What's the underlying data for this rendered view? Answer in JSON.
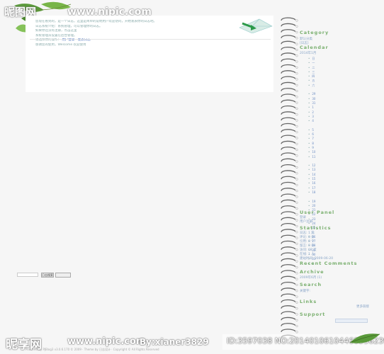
{
  "watermark": {
    "top_logo": "昵图网",
    "top_url": "www.nipic.com",
    "bottom_logo": "昵享网",
    "bottom_url": "www.nipic.com",
    "bottom_by": "By:xianer3829",
    "bottom_id": "ID:3597038 NO:20140106104460536239"
  },
  "content": {
    "lines": [
      {
        "text": "",
        "highlight": ""
      },
      {
        "text": "您现在看到的，是一个日志，这里是简单的说明用户欢迎访问，开始发表你的日志吧。",
        "highlight": ""
      },
      {
        "text": "日志系统介绍：系统管理，可以管理你的日志。",
        "highlight": ""
      },
      {
        "text": "如果你还没有注册，点击这里",
        "highlight": ""
      },
      {
        "text": "系统管理员设置在后台管理。",
        "highlight": ""
      },
      {
        "text": "请选择你的操作：",
        "highlight": "用户登录 · 发表日志"
      },
      {
        "text": "感谢您的使用，Welcome 欢迎使用",
        "highlight": ""
      }
    ]
  },
  "sidebar": {
    "category_title": "Category",
    "category_items": [
      "默认分类",
      "[日志]"
    ],
    "calendar_title": "Calendar",
    "calendar_month": "2014年1月",
    "calendar_days": [
      "日",
      "一",
      "二",
      "三",
      "四",
      "五",
      "六",
      "",
      "29",
      "30",
      "31",
      "1",
      "2",
      "3",
      "4",
      "",
      "5",
      "6",
      "7",
      "8",
      "9",
      "10",
      "11",
      "",
      "12",
      "13",
      "14",
      "15",
      "16",
      "17",
      "18",
      "",
      "19",
      "20",
      "21",
      "22",
      "23",
      "24",
      "25",
      "",
      "26",
      "27",
      "28",
      "29",
      "30",
      "31",
      "1"
    ],
    "user_panel_title": "User Panel",
    "user_panel_items": [
      "登录",
      "用户注册"
    ],
    "statistics_title": "Statistics",
    "statistics_items": [
      "日志: 1 篇",
      "评论: 0 条",
      "引用: 0 个",
      "留言: 0 条",
      "访问: 68 次",
      "在线: 1 人",
      "建站时间: 2009-06-20"
    ],
    "recent_comments_title": "Recent Comments",
    "archive_title": "Archive",
    "archive_items": [
      "2009年6月 (1)"
    ],
    "search_title": "Search",
    "search_labels": [
      "关键字:"
    ],
    "search_button": "日志搜索",
    "links_title": "Links",
    "links_more": "更多链接",
    "support_title": "Support"
  },
  "footer": {
    "text": "Powered by PJBlog3 v3.0.6.170 © 2009 · Theme by 日志设计 · Copyright © All Rights Reserved"
  },
  "colors": {
    "sidebar_title": "#7bb070",
    "link": "#3a66b8",
    "background": "#f6f6f6"
  }
}
